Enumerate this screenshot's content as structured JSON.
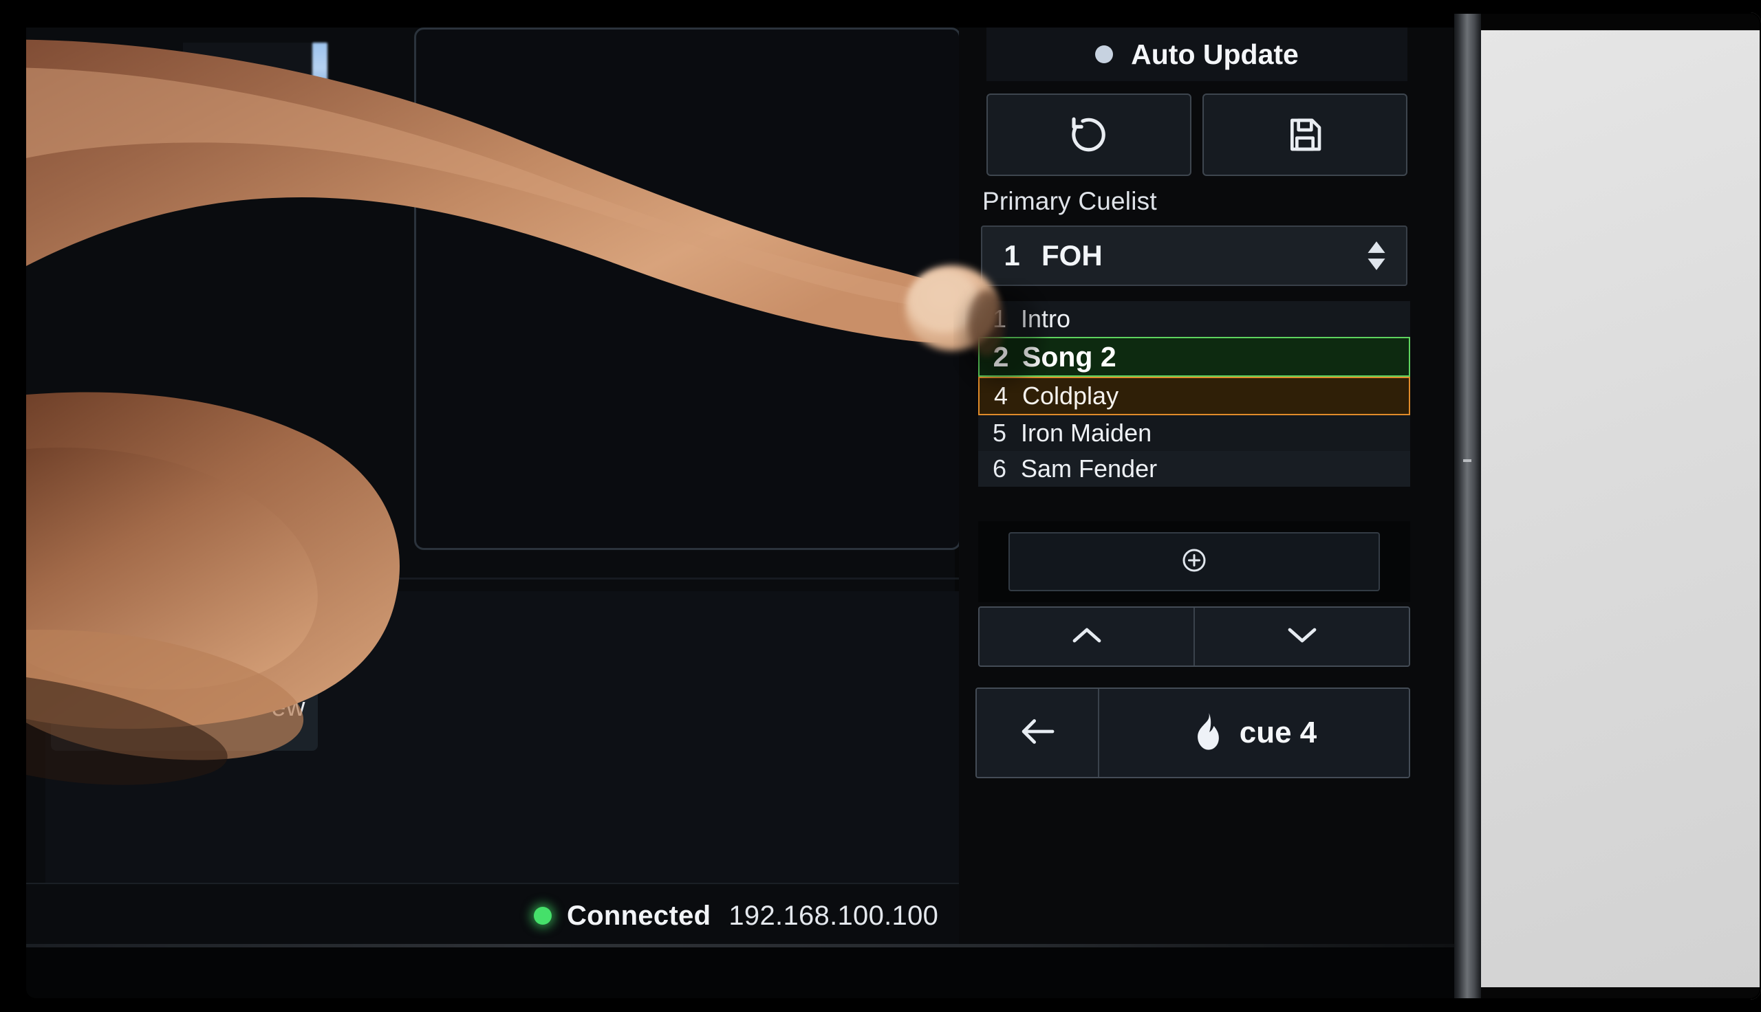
{
  "status": {
    "connection_label": "Connected",
    "ip_address": "192.168.100.100",
    "dot_color": "#45e06a"
  },
  "left_pane": {
    "partial_button_label": "ew"
  },
  "side_panel": {
    "auto_update": {
      "label": "Auto Update",
      "indicator_icon": "filled-circle-icon"
    },
    "actions": [
      {
        "name": "reset-button",
        "icon": "rotate-ccw-icon"
      },
      {
        "name": "save-button",
        "icon": "floppy-disk-icon"
      }
    ],
    "cuelist_section_label": "Primary Cuelist",
    "cuelist_select": {
      "number": "1",
      "name": "FOH",
      "stepper_icon": "up-down-stepper-icon"
    },
    "cues": [
      {
        "number": "1",
        "name": "Intro",
        "state": "normal"
      },
      {
        "number": "2",
        "name": "Song 2",
        "state": "active"
      },
      {
        "number": "4",
        "name": "Coldplay",
        "state": "next"
      },
      {
        "number": "5",
        "name": "Iron Maiden",
        "state": "normal"
      },
      {
        "number": "6",
        "name": "Sam Fender",
        "state": "normal"
      }
    ],
    "add_cue": {
      "icon": "plus-circle-icon"
    },
    "nav": [
      {
        "name": "cue-up-button",
        "icon": "chevron-up-icon"
      },
      {
        "name": "cue-down-button",
        "icon": "chevron-down-icon"
      }
    ],
    "go_bar": {
      "back_icon": "arrow-left-icon",
      "go_icon": "flame-icon",
      "go_label": "cue 4"
    }
  },
  "colors": {
    "active_cue_border": "#5fd45f",
    "active_cue_fill": "#0d2a10",
    "next_cue_border": "#e08b2a",
    "next_cue_fill": "#2f1f07",
    "status_connected": "#45e06a",
    "panel_background": "#090a0c",
    "button_border": "#3e464f"
  }
}
